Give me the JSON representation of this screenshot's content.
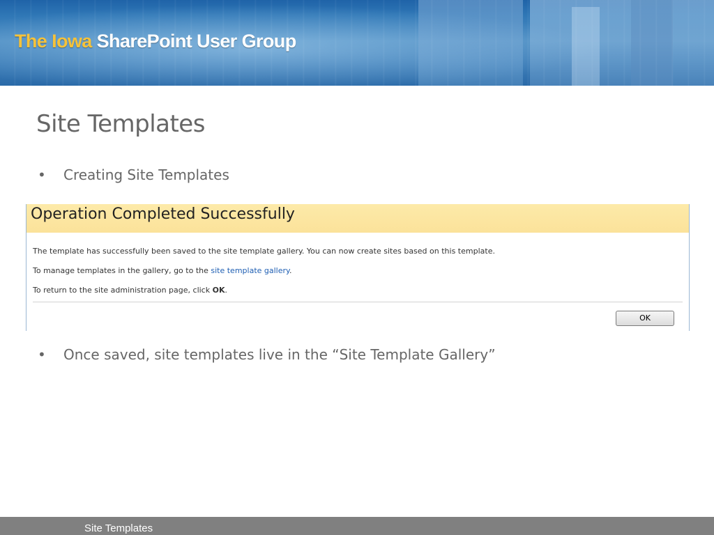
{
  "banner": {
    "brand_accent": "The Iowa",
    "brand_main": "SharePoint User Group",
    "accent_color": "#f5c23a"
  },
  "slide": {
    "title": "Site Templates",
    "bullets": [
      "Creating Site Templates",
      "Once saved, site templates live in the “Site Template Gallery”"
    ]
  },
  "dialog": {
    "heading": "Operation Completed Successfully",
    "line1": "The template has successfully been saved to the site template gallery. You can now create sites based on this template.",
    "line2_prefix": "To manage templates in the gallery, go to the ",
    "line2_link": "site template gallery",
    "line2_suffix": ".",
    "line3_prefix": "To return to the site administration page, click ",
    "line3_bold": "OK",
    "line3_suffix": ".",
    "ok_label": "OK"
  },
  "footer": {
    "text": "Site Templates"
  }
}
